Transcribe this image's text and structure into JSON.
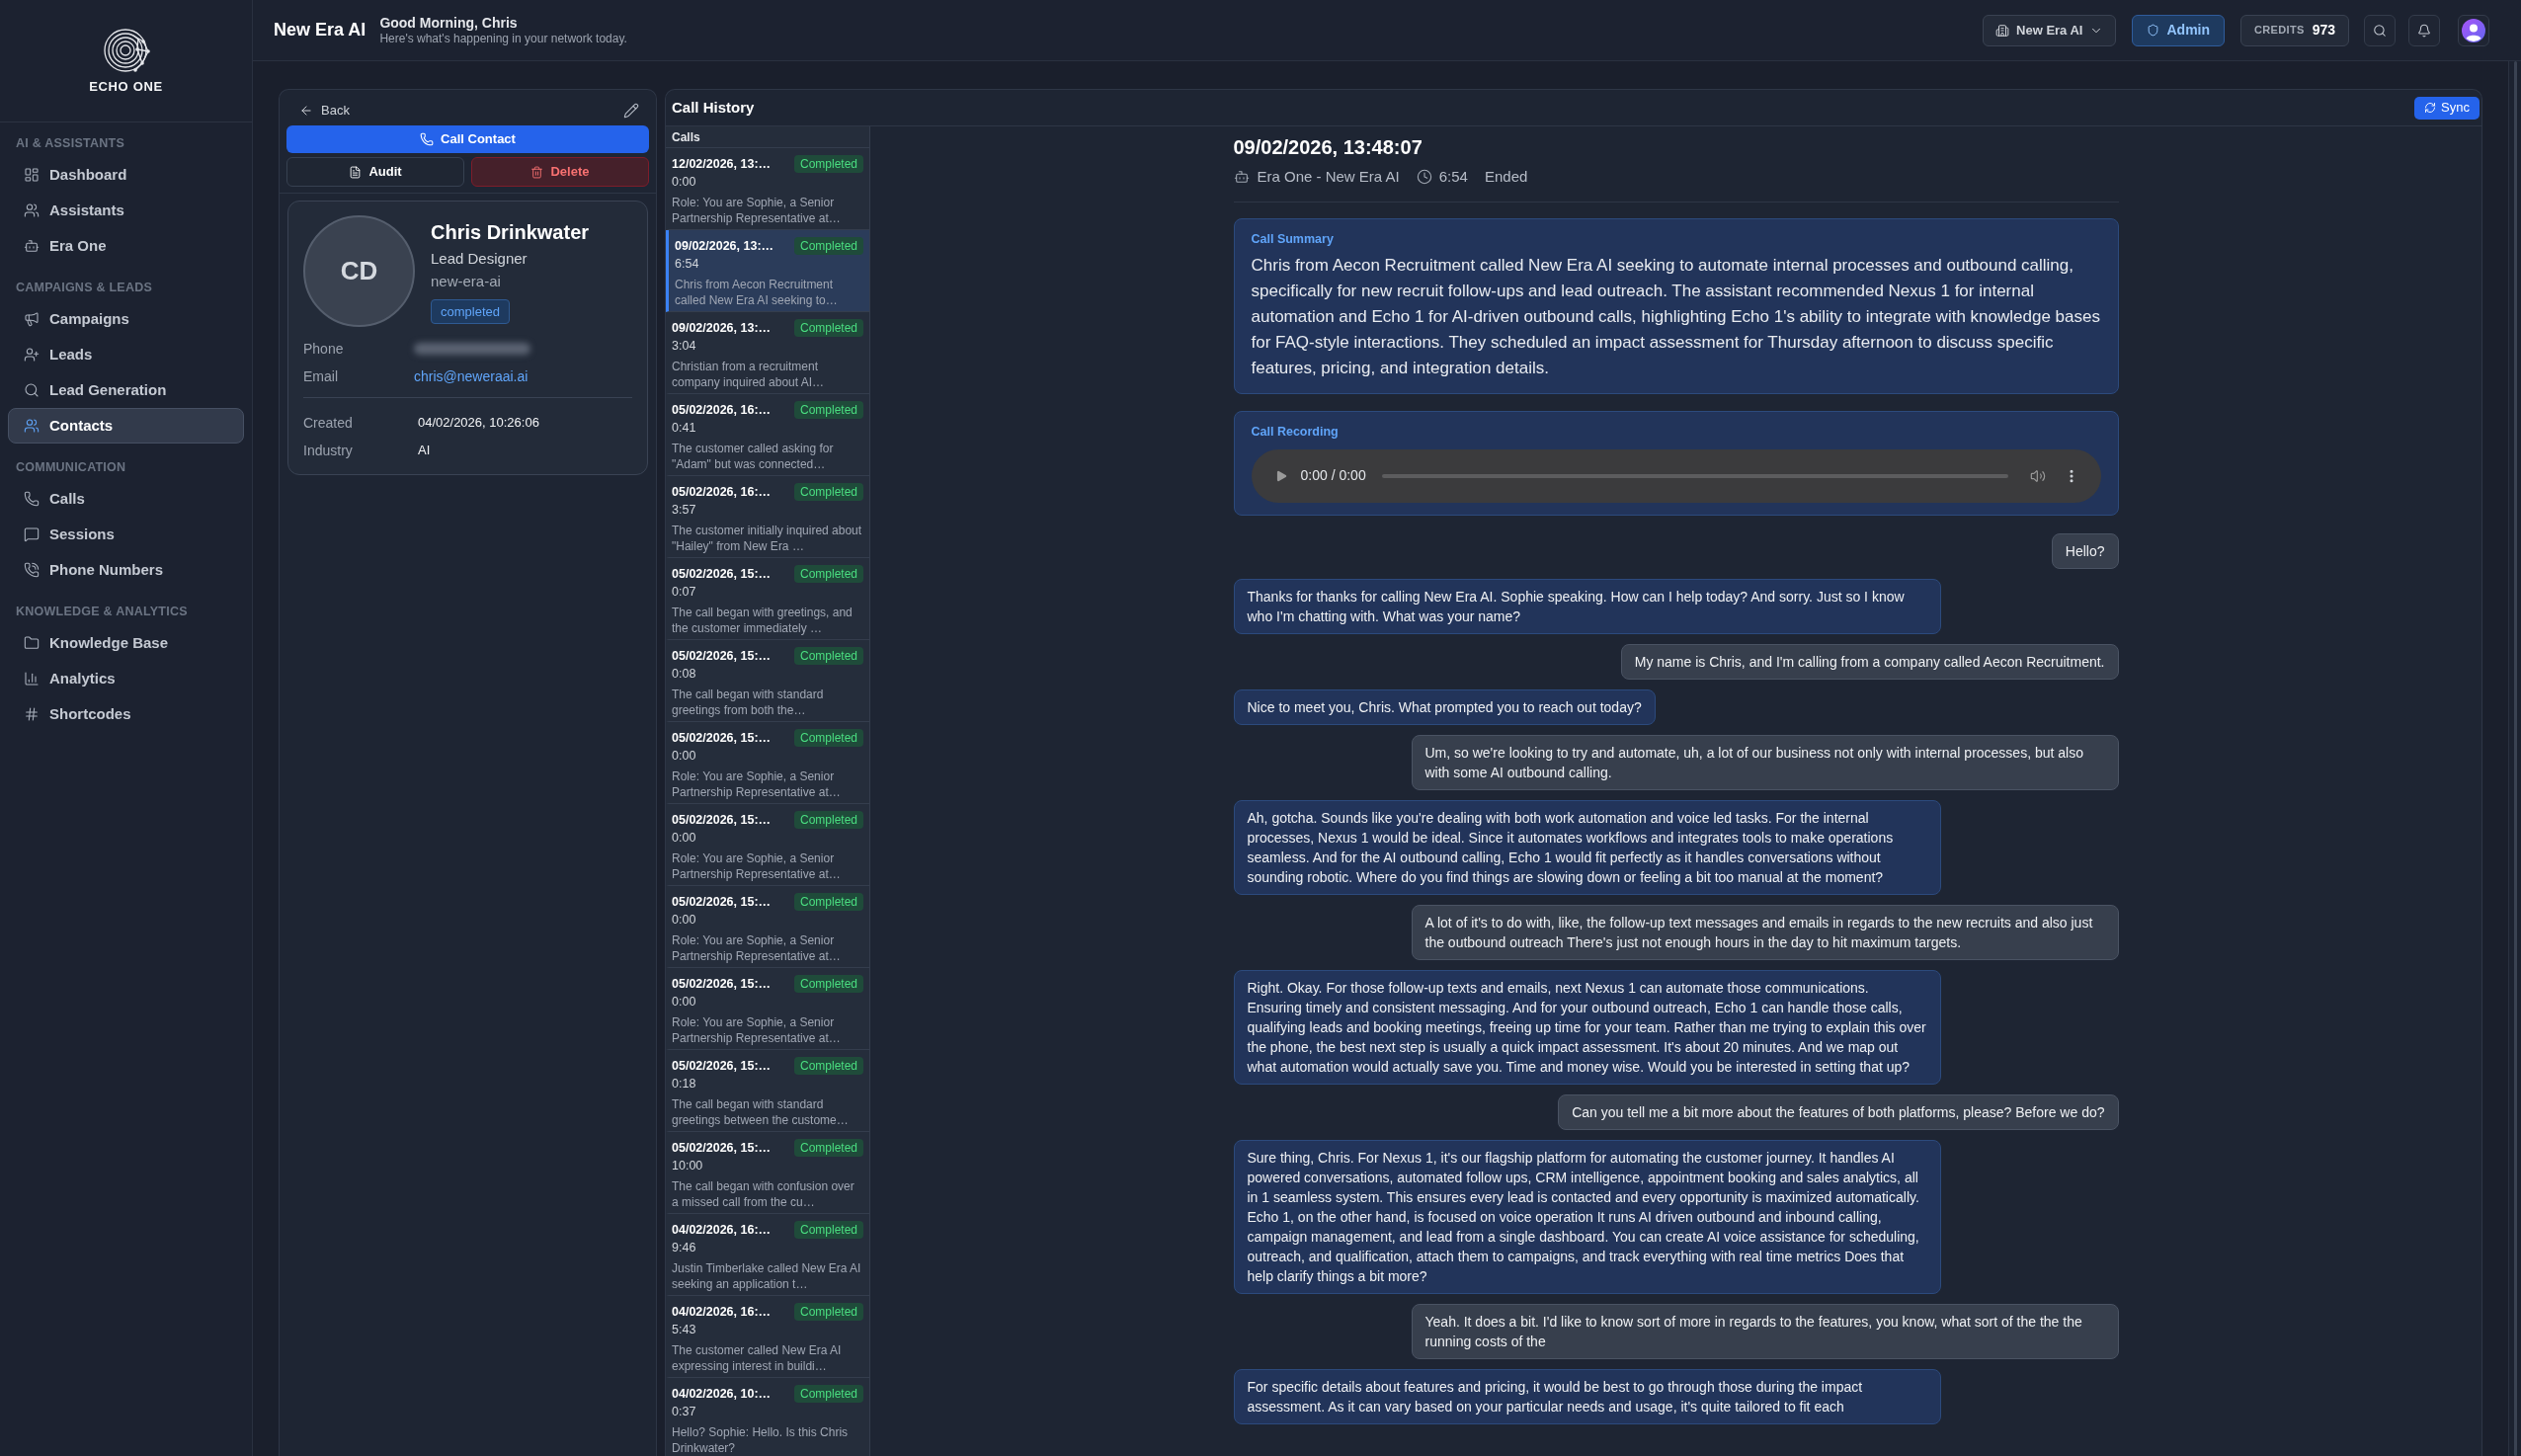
{
  "sidebar": {
    "logo_text": "ECHO ONE",
    "sections": [
      {
        "heading": "AI & ASSISTANTS",
        "items": [
          {
            "label": "Dashboard",
            "selected": false
          },
          {
            "label": "Assistants",
            "selected": false
          },
          {
            "label": "Era One",
            "selected": false
          }
        ]
      },
      {
        "heading": "CAMPAIGNS & LEADS",
        "items": [
          {
            "label": "Campaigns",
            "selected": false
          },
          {
            "label": "Leads",
            "selected": false
          },
          {
            "label": "Lead Generation",
            "selected": false
          },
          {
            "label": "Contacts",
            "selected": true
          }
        ]
      },
      {
        "heading": "COMMUNICATION",
        "items": [
          {
            "label": "Calls",
            "selected": false
          },
          {
            "label": "Sessions",
            "selected": false
          },
          {
            "label": "Phone Numbers",
            "selected": false
          }
        ]
      },
      {
        "heading": "KNOWLEDGE & ANALYTICS",
        "items": [
          {
            "label": "Knowledge Base",
            "selected": false
          },
          {
            "label": "Analytics",
            "selected": false
          },
          {
            "label": "Shortcodes",
            "selected": false
          }
        ]
      }
    ]
  },
  "header": {
    "title": "New Era AI",
    "greeting": "Good Morning, Chris",
    "subtitle": "Here's what's happening in your network today.",
    "workspace": "New Era AI",
    "role": "Admin",
    "credits_label": "CREDITS",
    "credits_value": "973"
  },
  "contact_panel": {
    "back": "Back",
    "call_button": "Call Contact",
    "audit_button": "Audit",
    "delete_button": "Delete",
    "initials": "CD",
    "name": "Chris Drinkwater",
    "job_title": "Lead Designer",
    "company": "new-era-ai",
    "status": "completed",
    "fields": [
      {
        "label": "Phone",
        "kind": "blurred"
      },
      {
        "label": "Email",
        "kind": "link",
        "value": "chris@neweraai.ai"
      }
    ],
    "details": [
      {
        "label": "Created",
        "value": "04/02/2026, 10:26:06"
      },
      {
        "label": "Industry",
        "value": "AI"
      }
    ]
  },
  "call_history": {
    "title": "Call History",
    "sync_button": "Sync",
    "list_heading": "Calls",
    "calls": [
      {
        "date": "12/02/2026, 13:…",
        "status": "Completed",
        "duration": "0:00",
        "preview": "Role: You are Sophie, a Senior Partnership Representative at…",
        "selected": false
      },
      {
        "date": "09/02/2026, 13:…",
        "status": "Completed",
        "duration": "6:54",
        "preview": "Chris from Aecon Recruitment called New Era AI seeking to…",
        "selected": true
      },
      {
        "date": "09/02/2026, 13:…",
        "status": "Completed",
        "duration": "3:04",
        "preview": "Christian from a recruitment company inquired about AI…",
        "selected": false
      },
      {
        "date": "05/02/2026, 16:…",
        "status": "Completed",
        "duration": "0:41",
        "preview": "The customer called asking for \"Adam\" but was connected…",
        "selected": false
      },
      {
        "date": "05/02/2026, 16:…",
        "status": "Completed",
        "duration": "3:57",
        "preview": "The customer initially inquired about \"Hailey\" from New Era …",
        "selected": false
      },
      {
        "date": "05/02/2026, 15:…",
        "status": "Completed",
        "duration": "0:07",
        "preview": "The call began with greetings, and the customer immediately …",
        "selected": false
      },
      {
        "date": "05/02/2026, 15:…",
        "status": "Completed",
        "duration": "0:08",
        "preview": "The call began with standard greetings from both the…",
        "selected": false
      },
      {
        "date": "05/02/2026, 15:…",
        "status": "Completed",
        "duration": "0:00",
        "preview": "Role: You are Sophie, a Senior Partnership Representative at…",
        "selected": false
      },
      {
        "date": "05/02/2026, 15:…",
        "status": "Completed",
        "duration": "0:00",
        "preview": "Role: You are Sophie, a Senior Partnership Representative at…",
        "selected": false
      },
      {
        "date": "05/02/2026, 15:…",
        "status": "Completed",
        "duration": "0:00",
        "preview": "Role: You are Sophie, a Senior Partnership Representative at…",
        "selected": false
      },
      {
        "date": "05/02/2026, 15:…",
        "status": "Completed",
        "duration": "0:00",
        "preview": "Role: You are Sophie, a Senior Partnership Representative at…",
        "selected": false
      },
      {
        "date": "05/02/2026, 15:…",
        "status": "Completed",
        "duration": "0:18",
        "preview": "The call began with standard greetings between the custome…",
        "selected": false
      },
      {
        "date": "05/02/2026, 15:…",
        "status": "Completed",
        "duration": "10:00",
        "preview": "The call began with confusion over a missed call from the cu…",
        "selected": false
      },
      {
        "date": "04/02/2026, 16:…",
        "status": "Completed",
        "duration": "9:46",
        "preview": "Justin Timberlake called New Era AI seeking an application t…",
        "selected": false
      },
      {
        "date": "04/02/2026, 16:…",
        "status": "Completed",
        "duration": "5:43",
        "preview": "The customer called New Era AI expressing interest in buildi…",
        "selected": false
      },
      {
        "date": "04/02/2026, 10:…",
        "status": "Completed",
        "duration": "0:37",
        "preview": "Hello? Sophie: Hello. Is this Chris Drinkwater?",
        "selected": false
      }
    ]
  },
  "call_detail": {
    "title": "09/02/2026, 13:48:07",
    "assistant": "Era One - New Era AI",
    "duration": "6:54",
    "state": "Ended",
    "summary_heading": "Call Summary",
    "summary": "Chris from Aecon Recruitment called New Era AI seeking to automate internal processes and outbound calling, specifically for new recruit follow-ups and lead outreach. The assistant recommended Nexus 1 for internal automation and Echo 1 for AI-driven outbound calls, highlighting Echo 1's ability to integrate with knowledge bases for FAQ-style interactions. They scheduled an impact assessment for Thursday afternoon to discuss specific features, pricing, and integration details.",
    "recording_heading": "Call Recording",
    "recording_time": "0:00 / 0:00",
    "messages": [
      {
        "kind": "user",
        "text": "Hello?"
      },
      {
        "kind": "assistant",
        "text": "Thanks for thanks for calling New Era AI. Sophie speaking. How can I help today? And sorry. Just so I know who I'm chatting with. What was your name?"
      },
      {
        "kind": "user",
        "text": "My name is Chris, and I'm calling from a company called Aecon Recruitment."
      },
      {
        "kind": "assistant",
        "text": "Nice to meet you, Chris. What prompted you to reach out today?"
      },
      {
        "kind": "user",
        "text": "Um, so we're looking to try and automate, uh, a lot of our business not only with internal processes, but also with some AI outbound calling."
      },
      {
        "kind": "assistant",
        "text": "Ah, gotcha. Sounds like you're dealing with both work automation and voice led tasks. For the internal processes, Nexus 1 would be ideal. Since it automates workflows and integrates tools to make operations seamless. And for the AI outbound calling, Echo 1 would fit perfectly as it handles conversations without sounding robotic. Where do you find things are slowing down or feeling a bit too manual at the moment?"
      },
      {
        "kind": "user",
        "text": "A lot of it's to do with, like, the follow-up text messages and emails in regards to the new recruits and also just the outbound outreach There's just not enough hours in the day to hit maximum targets."
      },
      {
        "kind": "assistant",
        "text": "Right. Okay. For those follow-up texts and emails, next Nexus 1 can automate those communications. Ensuring timely and consistent messaging. And for your outbound outreach, Echo 1 can handle those calls, qualifying leads and booking meetings, freeing up time for your team. Rather than me trying to explain this over the phone, the best next step is usually a quick impact assessment. It's about 20 minutes. And we map out what automation would actually save you. Time and money wise. Would you be interested in setting that up?"
      },
      {
        "kind": "user",
        "text": "Can you tell me a bit more about the features of both platforms, please? Before we do?"
      },
      {
        "kind": "assistant",
        "text": "Sure thing, Chris. For Nexus 1, it's our flagship platform for automating the customer journey. It handles AI powered conversations, automated follow ups, CRM intelligence, appointment booking and sales analytics, all in 1 seamless system. This ensures every lead is contacted and every opportunity is maximized automatically. Echo 1, on the other hand, is focused on voice operation It runs AI driven outbound and inbound calling, campaign management, and lead from a single dashboard. You can create AI voice assistance for scheduling, outreach, and qualification, attach them to campaigns, and track everything with real time metrics Does that help clarify things a bit more?"
      },
      {
        "kind": "user",
        "text": "Yeah. It does a bit. I'd like to know sort of more in regards to the features, you know, what sort of the the the running costs of the"
      },
      {
        "kind": "assistant",
        "text": "For specific details about features and pricing, it would be best to go through those during the impact assessment. As it can vary based on your particular needs and usage, it's quite tailored to fit each"
      }
    ]
  }
}
